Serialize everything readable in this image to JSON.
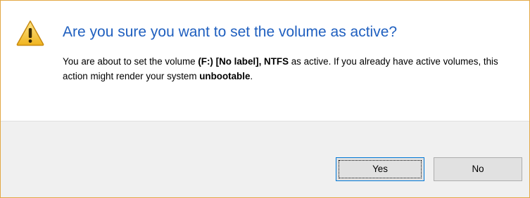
{
  "dialog": {
    "title": "Are you sure you want to set the volume as active?",
    "message": {
      "part1": "You are about to set the volume ",
      "volume": "(F:) [No label], NTFS",
      "part2": " as active. If you already have active volumes, this action might render your system ",
      "emphasis": "unbootable",
      "part3": "."
    },
    "icon": "warning-icon"
  },
  "buttons": {
    "yes_label": "Yes",
    "no_label": "No"
  },
  "colors": {
    "title": "#1f5fbf",
    "border": "#e3a845",
    "footer_bg": "#f0f0f0",
    "warning_fill": "#f5c02e"
  }
}
